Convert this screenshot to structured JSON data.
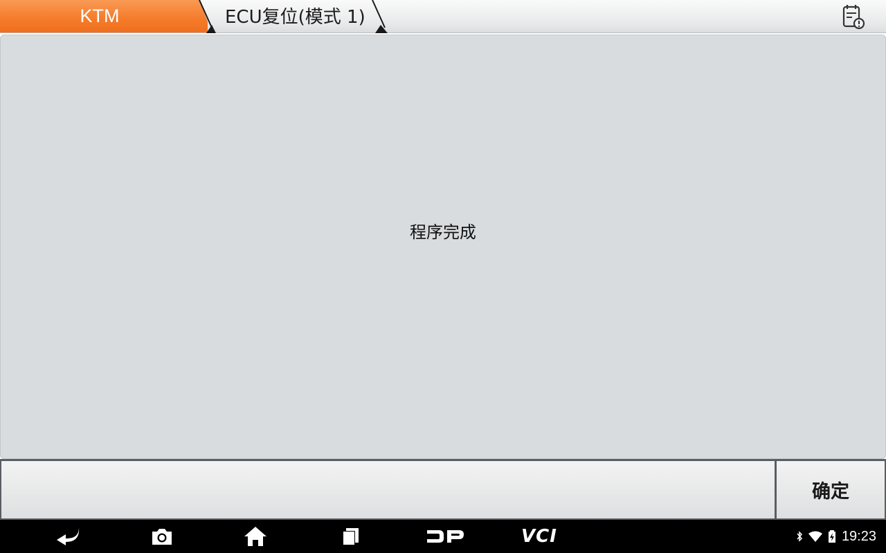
{
  "topbar": {
    "breadcrumb_root": "KTM",
    "breadcrumb_current": "ECU复位(模式 1)",
    "report_icon": "report-icon"
  },
  "content": {
    "message": "程序完成"
  },
  "actions": {
    "confirm_label": "确定"
  },
  "navbar": {
    "icons": [
      "back-icon",
      "screenshot-icon",
      "home-icon",
      "recents-icon",
      "dp-icon",
      "vci-icon"
    ],
    "dp_label": "DP",
    "vci_label": "VCI"
  },
  "status": {
    "icons": [
      "bluetooth-icon",
      "wifi-icon",
      "battery-icon"
    ],
    "time": "19:23"
  },
  "colors": {
    "accent": "#f57d2c",
    "panel": "#d8dcdf",
    "navbar": "#000000"
  }
}
